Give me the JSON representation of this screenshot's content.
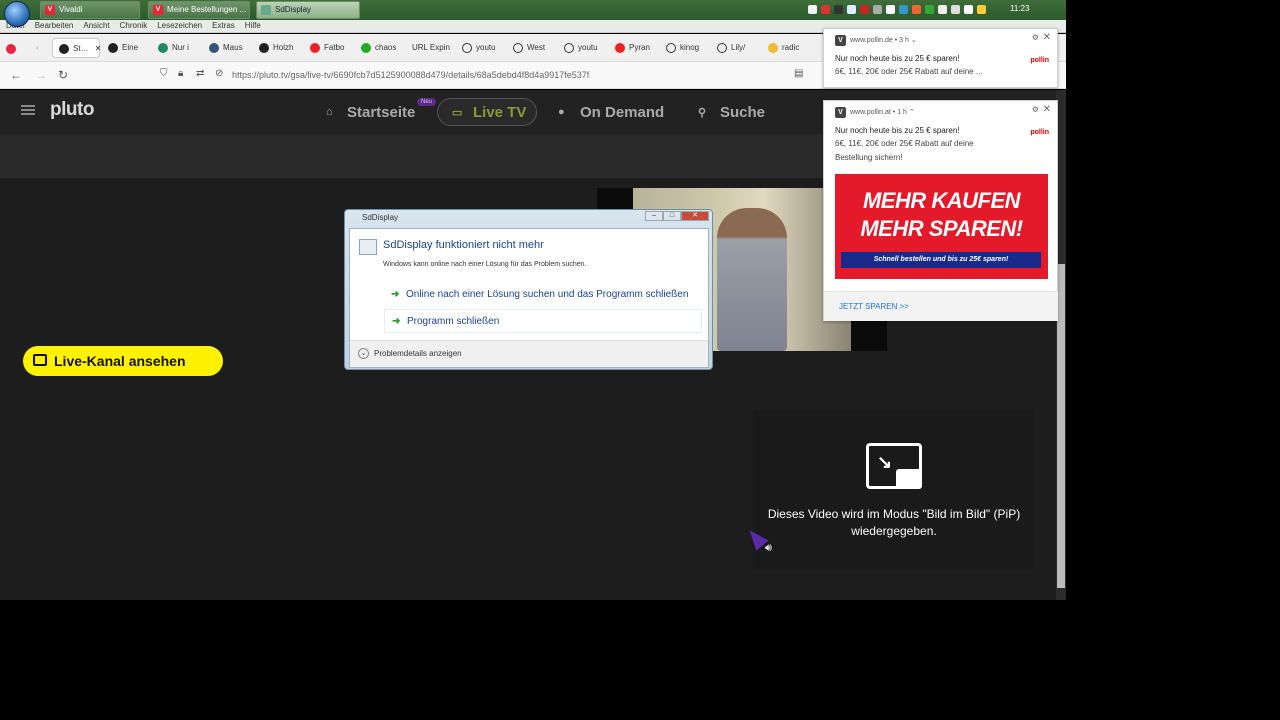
{
  "taskbar": {
    "tasks": [
      {
        "label": "Vivaldi"
      },
      {
        "label": "Meine Bestellungen ..."
      },
      {
        "label": "SdDisplay"
      }
    ],
    "clock": "11:23"
  },
  "menubar": {
    "items": [
      "Datei",
      "Bearbeiten",
      "Ansicht",
      "Chronik",
      "Lesezeichen",
      "Extras",
      "Hilfe"
    ]
  },
  "browser": {
    "tabs": [
      "St…",
      "Eine",
      "Nur i",
      "Maus",
      "Holzh",
      "Fatbo",
      "chaos",
      "URL Expin",
      "youtu",
      "West",
      "youtu",
      "Pyran",
      "kinog",
      "Lily/",
      "radic"
    ],
    "url": "https://pluto.tv/gsa/live-tv/6690fcb7d5125900088d479/details/68a5debd4f8d4a9917fe537f"
  },
  "pluto": {
    "logo": "pluto",
    "nav": {
      "home": "Startseite",
      "live": "Live TV",
      "ondemand": "On Demand",
      "search": "Suche",
      "badge": "Neu"
    },
    "live_button": "Live-Kanal ansehen",
    "pip_message_1": "Dieses Video wird im Modus \"Bild im Bild\" (PiP)",
    "pip_message_2": "wiedergegeben."
  },
  "dialog": {
    "title": "SdDisplay",
    "heading": "SdDisplay funktioniert nicht mehr",
    "subtitle": "Windows kann online nach einer Lösung für das Problem suchen.",
    "option1": "Online nach einer Lösung suchen und das Programm schließen",
    "option2": "Programm schließen",
    "details": "Problemdetails anzeigen"
  },
  "notifications": [
    {
      "site": "www.pollin.de",
      "age": "3 h",
      "title": "Nur noch heute bis zu 25 € sparen!",
      "text": "6€, 11€, 20€ oder 25€ Rabatt auf deine ...",
      "logo": "pollin"
    },
    {
      "site": "www.pollin.at",
      "age": "1 h",
      "title": "Nur noch heute bis zu 25 € sparen!",
      "text": "6€, 11€, 20€ oder 25€ Rabatt auf deine Bestellung sichern!",
      "logo": "pollin",
      "banner_line1": "MEHR KAUFEN",
      "banner_line2": "MEHR SPAREN!",
      "banner_strip": "Schnell bestellen und bis zu 25€ sparen!",
      "cta": "JETZT SPAREN >>"
    }
  ]
}
